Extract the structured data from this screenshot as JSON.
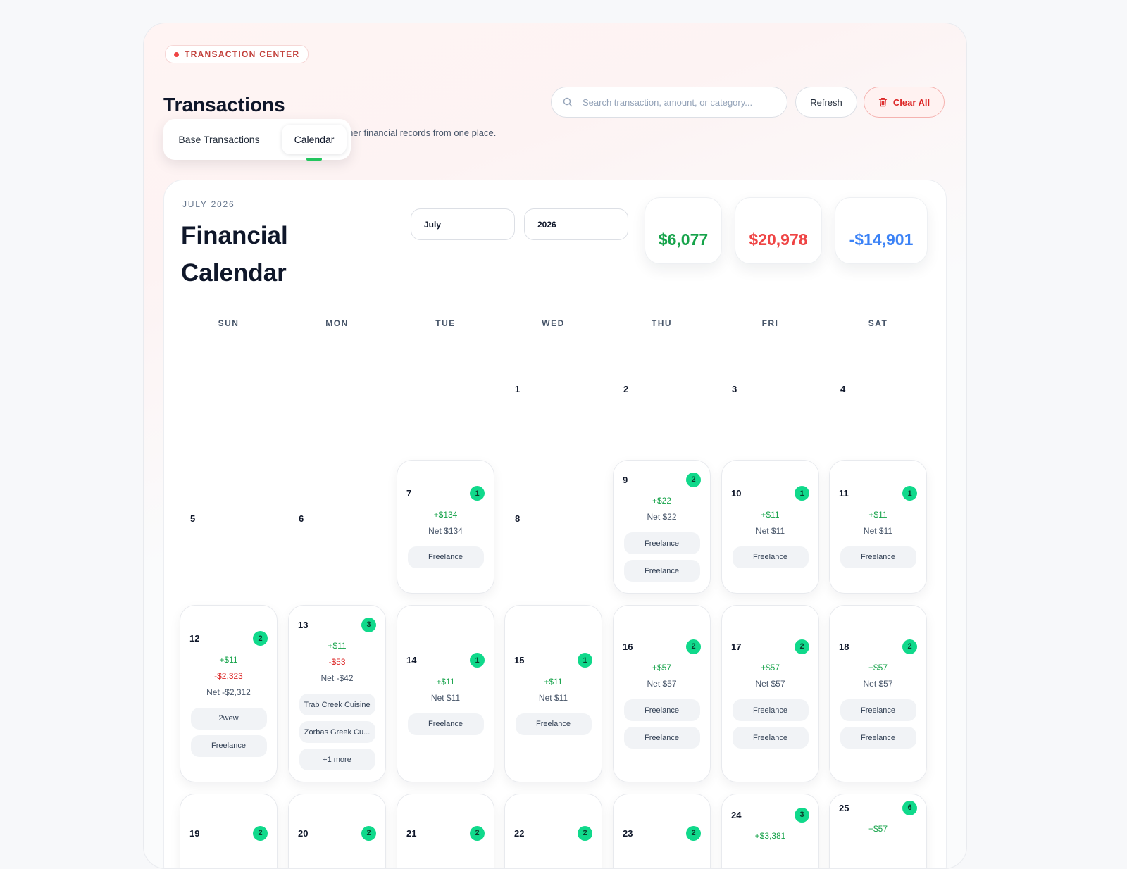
{
  "header": {
    "badge": "TRANSACTION CENTER",
    "title": "Transactions",
    "subtitle": "Search, edit, manage activity, and export cleaner financial records from one place.",
    "search_placeholder": "Search transaction, amount, or category...",
    "refresh_label": "Refresh",
    "clear_label": "Clear All"
  },
  "tabs": [
    "Base Transactions",
    "Calendar"
  ],
  "calendar": {
    "eyebrow": "JULY 2026",
    "title": "Financial Calendar",
    "month_select": "July",
    "year_select": "2026",
    "summary": {
      "income": "$6,077",
      "expense": "$20,978",
      "net": "-$14,901"
    },
    "weekdays": [
      "SUN",
      "MON",
      "TUE",
      "WED",
      "THU",
      "FRI",
      "SAT"
    ],
    "empty_days": [
      "1",
      "2",
      "3",
      "4",
      "5",
      "6",
      "8"
    ],
    "days": {
      "d7": {
        "day": "7",
        "count": "1",
        "inc": "+$134",
        "net": "Net $134",
        "tags": [
          "Freelance"
        ]
      },
      "d9": {
        "day": "9",
        "count": "2",
        "inc": "+$22",
        "net": "Net $22",
        "tags": [
          "Freelance",
          "Freelance"
        ]
      },
      "d10": {
        "day": "10",
        "count": "1",
        "inc": "+$11",
        "net": "Net $11",
        "tags": [
          "Freelance"
        ]
      },
      "d11": {
        "day": "11",
        "count": "1",
        "inc": "+$11",
        "net": "Net $11",
        "tags": [
          "Freelance"
        ]
      },
      "d12": {
        "day": "12",
        "count": "2",
        "inc": "+$11",
        "exp": "-$2,323",
        "net": "Net -$2,312",
        "tags": [
          "2wew",
          "Freelance"
        ]
      },
      "d13": {
        "day": "13",
        "count": "3",
        "inc": "+$11",
        "exp": "-$53",
        "net": "Net -$42",
        "tags": [
          "Trab Creek Cuisine",
          "Zorbas Greek Cu...",
          "+1 more"
        ]
      },
      "d14": {
        "day": "14",
        "count": "1",
        "inc": "+$11",
        "net": "Net $11",
        "tags": [
          "Freelance"
        ]
      },
      "d15": {
        "day": "15",
        "count": "1",
        "inc": "+$11",
        "net": "Net $11",
        "tags": [
          "Freelance"
        ]
      },
      "d16": {
        "day": "16",
        "count": "2",
        "inc": "+$57",
        "net": "Net $57",
        "tags": [
          "Freelance",
          "Freelance"
        ]
      },
      "d17": {
        "day": "17",
        "count": "2",
        "inc": "+$57",
        "net": "Net $57",
        "tags": [
          "Freelance",
          "Freelance"
        ]
      },
      "d18": {
        "day": "18",
        "count": "2",
        "inc": "+$57",
        "net": "Net $57",
        "tags": [
          "Freelance",
          "Freelance"
        ]
      },
      "d19": {
        "day": "19",
        "count": "2"
      },
      "d20": {
        "day": "20",
        "count": "2"
      },
      "d21": {
        "day": "21",
        "count": "2"
      },
      "d22": {
        "day": "22",
        "count": "2"
      },
      "d23": {
        "day": "23",
        "count": "2"
      },
      "d24": {
        "day": "24",
        "count": "3",
        "inc": "+$3,381"
      },
      "d25": {
        "day": "25",
        "count": "6",
        "inc": "+$57"
      }
    }
  },
  "colors": {
    "income": "#16a34a",
    "expense": "#ef4444",
    "net": "#3b82f6",
    "count_badge": "#10d98b"
  }
}
